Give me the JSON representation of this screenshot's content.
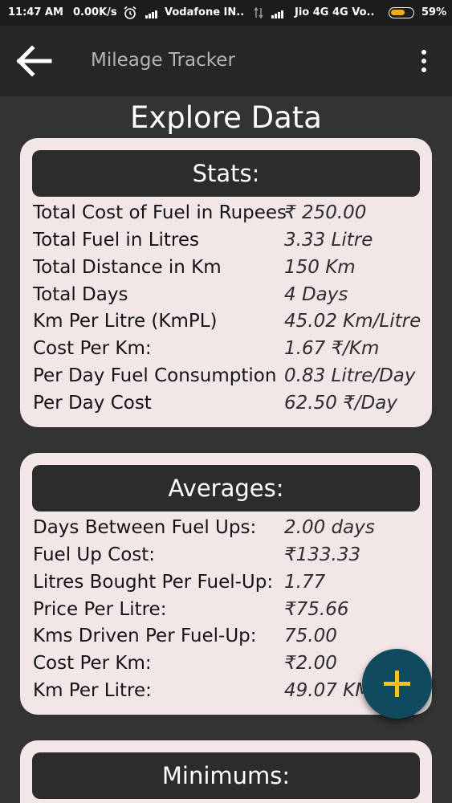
{
  "status_bar": {
    "time": "11:47 AM",
    "speed": "0.00K/s",
    "carrier1": "Vodafone IN..",
    "carrier2": "Jio 4G 4G Vo..",
    "battery": "59%",
    "icons": [
      "alarm-icon",
      "signal-icon",
      "data-icon",
      "battery-icon"
    ]
  },
  "app_bar": {
    "title": "Mileage Tracker",
    "back_icon": "arrow-left-icon",
    "menu_icon": "more-vert-icon"
  },
  "page": {
    "title": "Explore Data"
  },
  "stats": {
    "header": "Stats:",
    "rows": [
      {
        "label": "Total Cost of Fuel in Rupees",
        "value": "₹ 250.00"
      },
      {
        "label": "Total Fuel in Litres",
        "value": "3.33 Litre"
      },
      {
        "label": "Total Distance in Km",
        "value": "150 Km"
      },
      {
        "label": "Total Days",
        "value": "4 Days"
      },
      {
        "label": "Km Per Litre (KmPL)",
        "value": "45.02 Km/Litre"
      },
      {
        "label": "Cost Per Km:",
        "value": "1.67 ₹/Km"
      },
      {
        "label": "Per Day Fuel Consumption",
        "value": "0.83 Litre/Day"
      },
      {
        "label": "Per Day Cost",
        "value": "62.50 ₹/Day"
      }
    ]
  },
  "averages": {
    "header": "Averages:",
    "rows": [
      {
        "label": "Days Between Fuel Ups:",
        "value": "2.00 days"
      },
      {
        "label": "Fuel Up Cost:",
        "value": "₹133.33"
      },
      {
        "label": "Litres Bought Per Fuel-Up:",
        "value": "1.77"
      },
      {
        "label": "Price Per Litre:",
        "value": "₹75.66"
      },
      {
        "label": "Kms Driven Per Fuel-Up:",
        "value": "75.00"
      },
      {
        "label": "Cost Per Km:",
        "value": "₹2.00"
      },
      {
        "label": "Km Per Litre:",
        "value": "49.07 KM"
      }
    ]
  },
  "minimums": {
    "header": "Minimums:"
  },
  "fab": {
    "icon": "plus-icon",
    "color": "#0f4a5e",
    "icon_color": "#f6c21b"
  }
}
